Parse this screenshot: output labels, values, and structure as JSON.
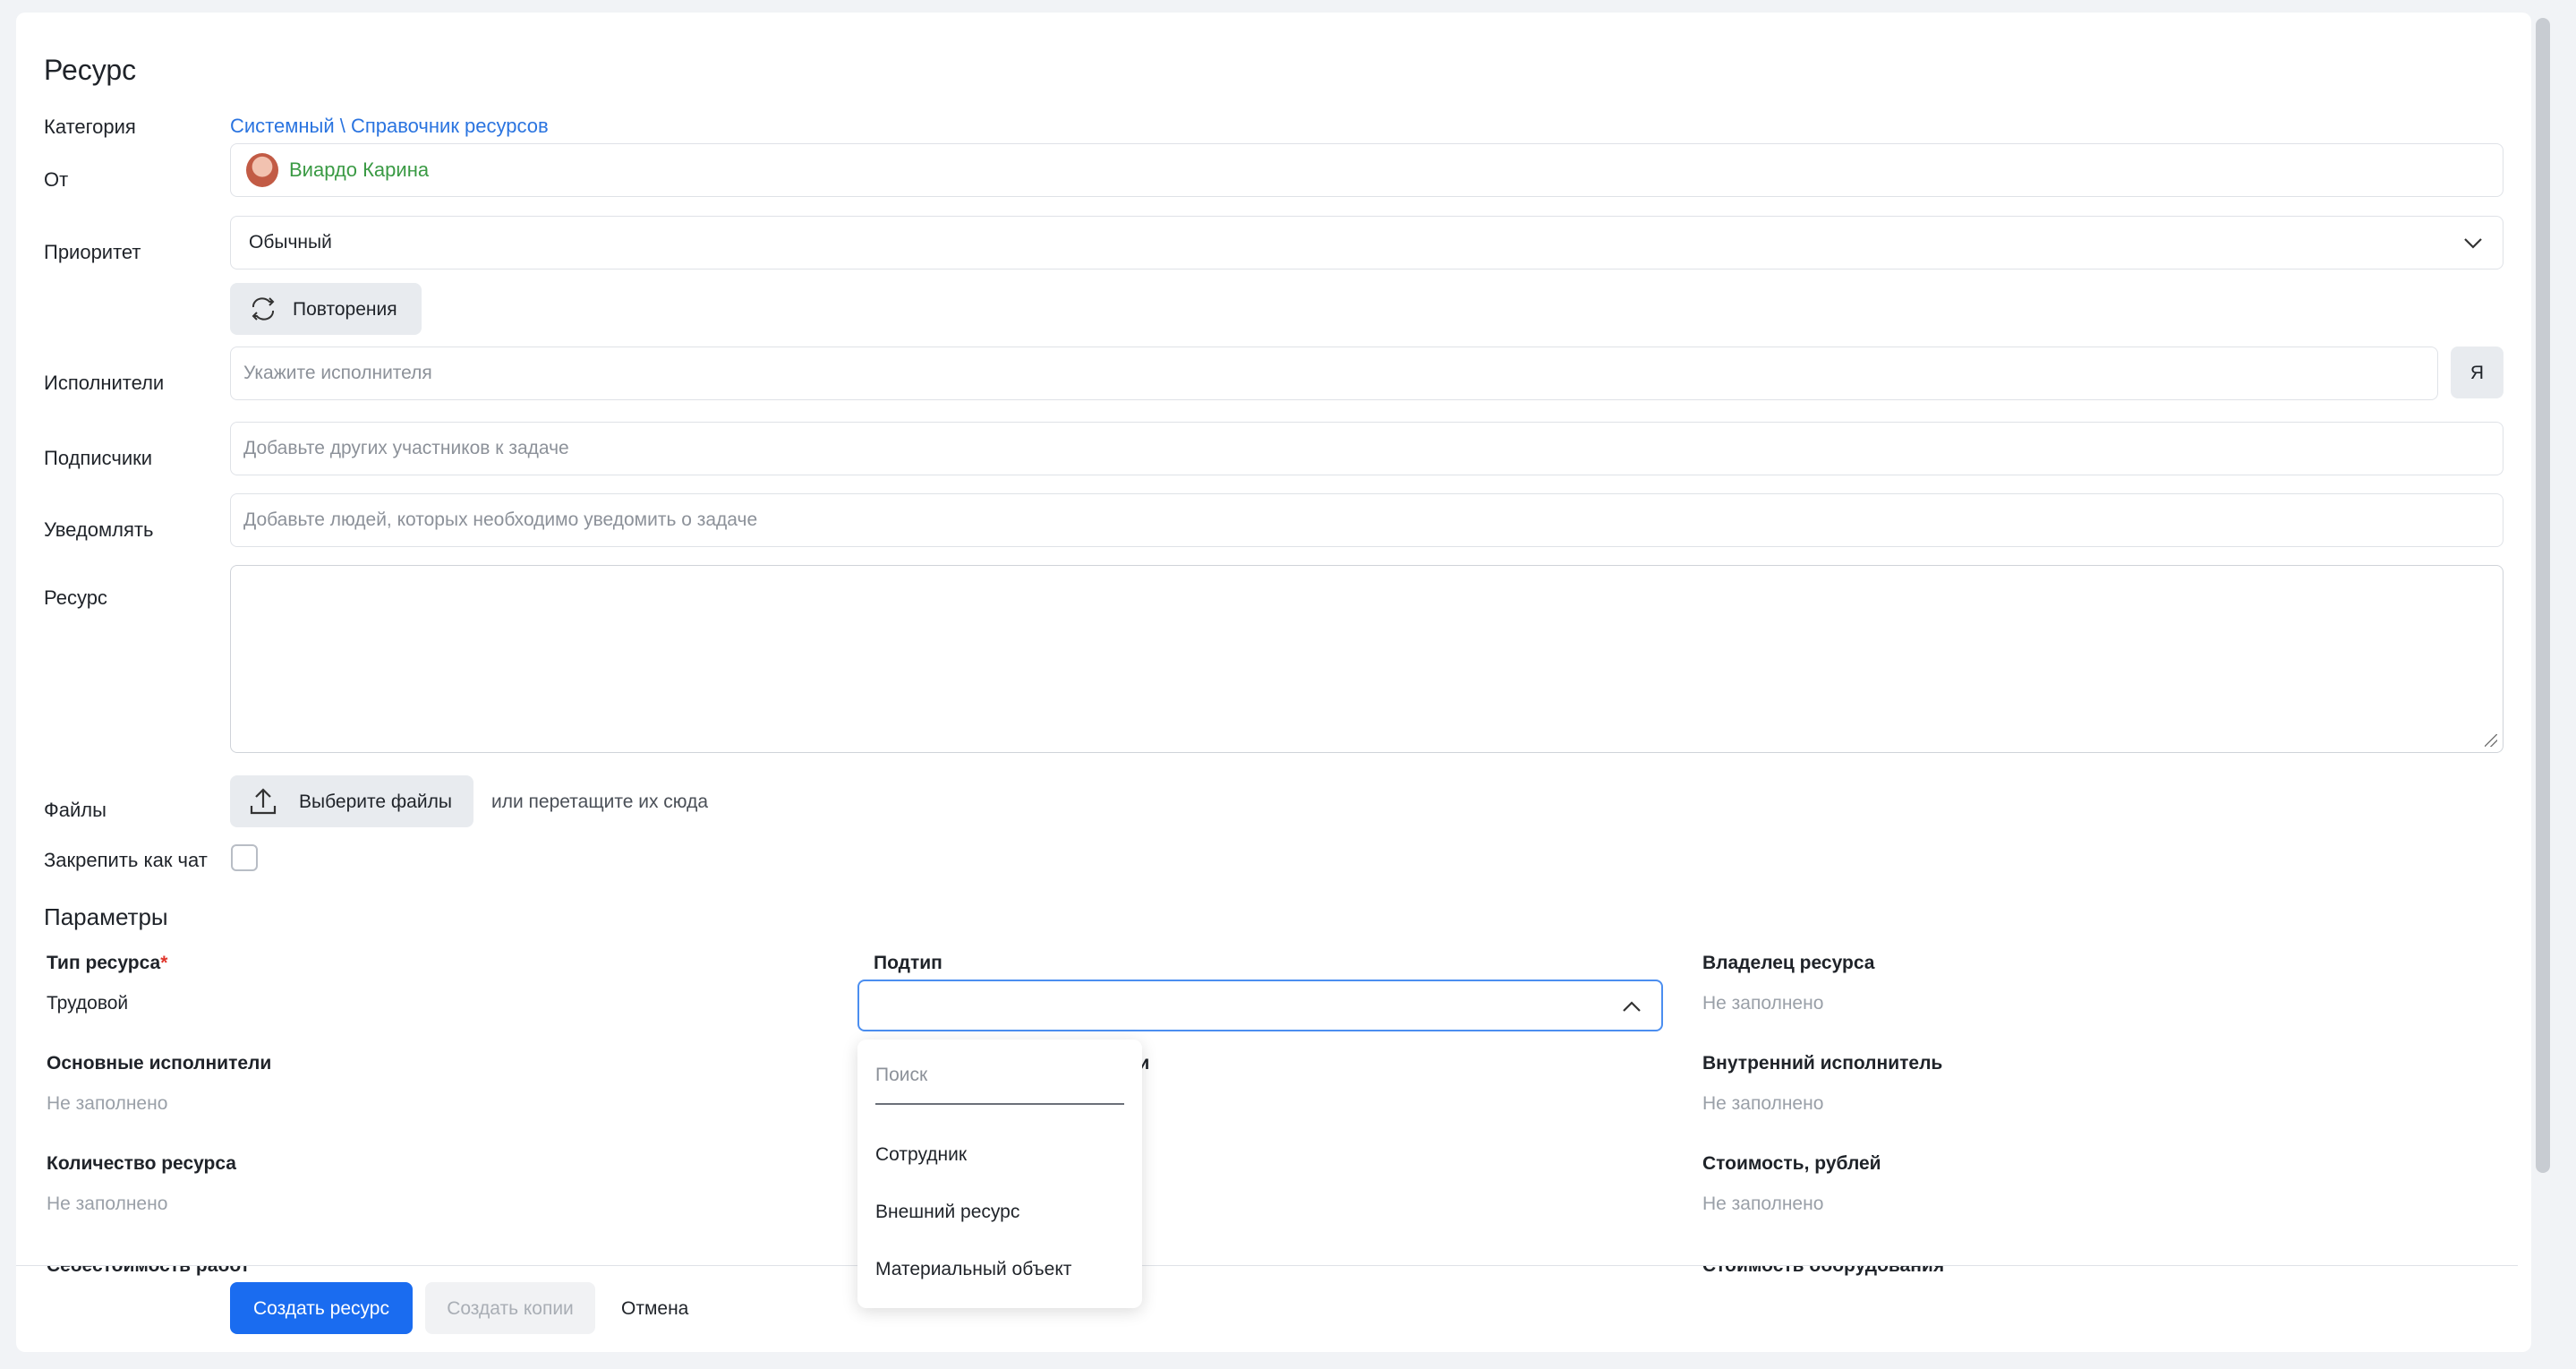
{
  "form": {
    "title": "Ресурс",
    "category_label": "Категория",
    "category_value": "Системный \\ Справочник ресурсов",
    "from_label": "От",
    "from_name": "Виардо Карина",
    "priority_label": "Приоритет",
    "priority_value": "Обычный",
    "repeat_button": "Повторения",
    "assignees_label": "Исполнители",
    "assignees_placeholder": "Укажите исполнителя",
    "me_button": "Я",
    "subscribers_label": "Подписчики",
    "subscribers_placeholder": "Добавьте других участников к задаче",
    "notify_label": "Уведомлять",
    "notify_placeholder": "Добавьте людей, которых необходимо уведомить о задаче",
    "resource_label": "Ресурс",
    "files_label": "Файлы",
    "files_button": "Выберите файлы",
    "files_hint": "или перетащите их сюда",
    "pin_chat_label": "Закрепить как чат"
  },
  "params": {
    "section_title": "Параметры",
    "resource_type_label": "Тип ресурса",
    "required_mark": "*",
    "resource_type_value": "Трудовой",
    "subtype_label": "Подтип",
    "owner_label": "Владелец ресурса",
    "owner_value": "Не заполнено",
    "main_assignees_label": "Основные исполнители",
    "main_assignees_value": "Не заполнено",
    "hidden_label_tail": "ли",
    "internal_assignee_label": "Внутренний исполнитель",
    "internal_assignee_value": "Не заполнено",
    "quantity_label": "Количество ресурса",
    "quantity_value": "Не заполнено",
    "cost_label": "Стоимость, рублей",
    "cost_value": "Не заполнено",
    "cut_label_left": "Себестоимость работ",
    "cut_label_right": "Стоимость оборудования"
  },
  "dropdown": {
    "search_placeholder": "Поиск",
    "options": [
      "Сотрудник",
      "Внешний ресурс",
      "Материальный объект"
    ]
  },
  "footer": {
    "create_button": "Создать ресурс",
    "copies_button": "Создать копии",
    "cancel_button": "Отмена"
  },
  "colors": {
    "accent": "#1a6cf0",
    "link": "#2a74e0",
    "user_name": "#3a9a44",
    "required": "#e0352b"
  }
}
